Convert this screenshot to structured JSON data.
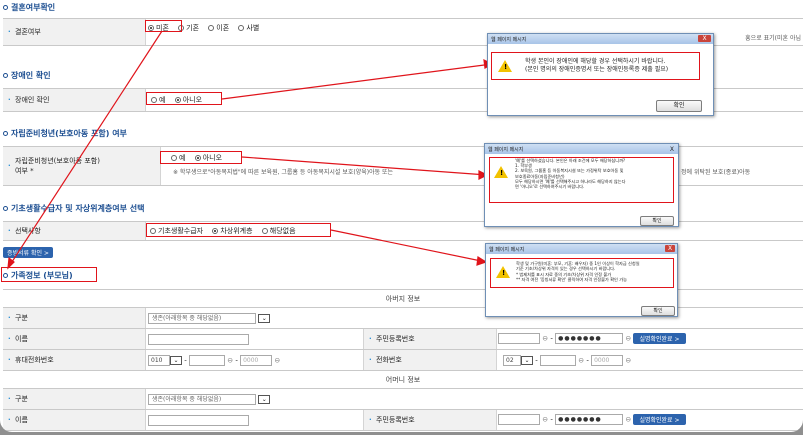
{
  "sections": {
    "marriage": "결혼여부확인",
    "disability": "장애인 확인",
    "selfsupport": "자립준비청년(보호아동 포함) 여부",
    "basic": "기초생활수급자 및 자상위계층여부 선택",
    "family": "가족정보 (부모님)"
  },
  "marriage_row": {
    "label": "결혼여부",
    "options": [
      "미혼",
      "기혼",
      "이혼",
      "사별"
    ],
    "selected": "미혼",
    "side_note": "흥으로 표기(미혼 아님"
  },
  "disability_row": {
    "label": "장애인 확인",
    "options": [
      "예",
      "아니오"
    ],
    "selected": "아니오"
  },
  "selfsupport_row": {
    "label_line1": "자립준비청년(보호아동 포함)",
    "label_line2": "여부 *",
    "options": [
      "예",
      "아니오"
    ],
    "selected": "아니오",
    "note": "※ 학부생으로\"아동복지법\"에 따른 보육원, 그룹홈 등 아동복지시설 보호(양육)아동 또는",
    "note_right": "정에 위탁된 보호(종료)아동"
  },
  "basic_row": {
    "label": "선택사항",
    "options": [
      "기초생활수급자",
      "차상위계층",
      "해당없음"
    ],
    "selected": "차상위계층"
  },
  "proof_button": "증빙서류 확인 >",
  "family": {
    "father_header": "아버지 정보",
    "mother_header": "어머니 정보",
    "gubun_label": "구분",
    "gubun_value": "생존(아래항목 중 해당없음)",
    "name_label": "이름",
    "rrn_label": "주민등록번호",
    "rrn_masked": "●●●●●●●",
    "verify_button": "실명확인완료 >",
    "mobile_label": "휴대전화번호",
    "mobile_prefix": "010",
    "mobile_placeholder": "0000",
    "phone_label": "전화번호",
    "phone_prefix": "02",
    "phone_placeholder": "0000",
    "dash": "-"
  },
  "dialog1": {
    "title": "웹 페이지 메시지",
    "close": "X",
    "message_line1": "학생 본인이 장애인에 해당할 경우 선택하시기 바랍니다.",
    "message_line2": "(본인 명의의 장애인증명서 또는 장애인등록증 제출 필요)",
    "ok": "확인"
  },
  "dialog2": {
    "title": "웹 페이지 메시지",
    "close": "X",
    "lines": [
      "'예'를 선택하셨습니다. 본인은 아래 조건에 모두 해당하십니까?",
      "1. 학부생",
      "2. 보육원, 그룹홈 등 아동복지시설 또는 가정위탁 보호아동 및",
      "보호종료아동(자립준비청년)",
      "모두 해당하시면 '예'를 선택해주시고 하나라도 해당하지 않는다",
      "면 '아니오'로 선택하여주시기 바랍니다."
    ],
    "ok": "확인"
  },
  "dialog3": {
    "title": "웹 페이지 메시지",
    "close": "X",
    "lines": [
      "학생 및 가구원(미혼: 부모, 기혼: 배우자) 중 1인 이상이 학자금 신청일",
      "기준 기초/차상위 자격이 있는 경우 선택하시기 바랍니다.",
      "* 법제처를 표시 자료 중의 기초/차상위 자격 인정 불가",
      "** 자격 여전 '증빙서류 확인' 클릭하여 자격 인정불가 확인 가능"
    ],
    "ok": "확인"
  },
  "colors": {
    "highlight": "#e0141b",
    "section": "#1c4e91",
    "button": "#2c63ad"
  }
}
